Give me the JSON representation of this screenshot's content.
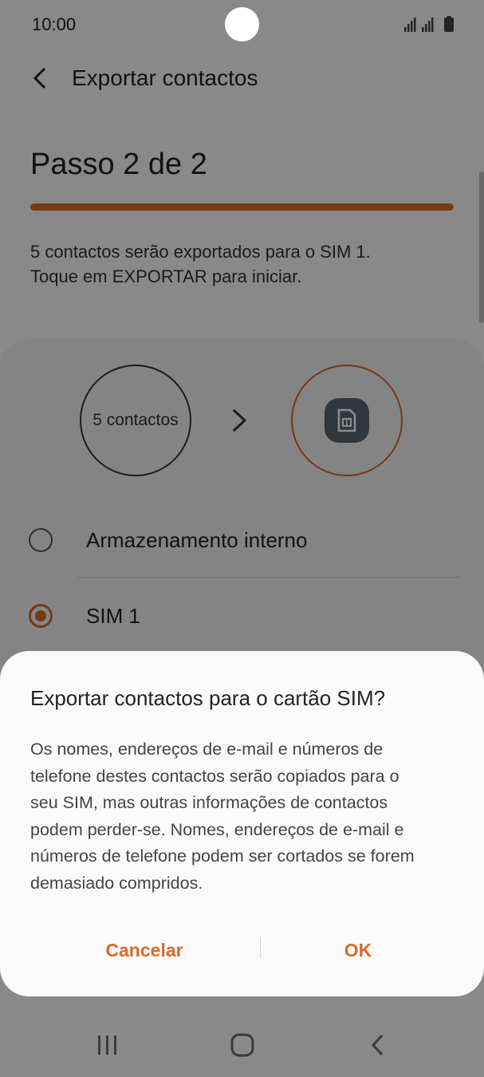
{
  "status_bar": {
    "time": "10:00",
    "signal_icon": "signal-icon",
    "battery_icon": "battery-icon"
  },
  "header": {
    "title": "Exportar contactos",
    "back_icon": "chevron-left-icon"
  },
  "step": {
    "title": "Passo 2 de 2",
    "progress": 1.0
  },
  "description": {
    "line1": "5 contactos serão exportados para o SIM 1.",
    "line2": "Toque em EXPORTAR para iniciar."
  },
  "transfer": {
    "source_label": "5 contactos",
    "arrow_icon": "chevron-right-icon",
    "target_icon": "sim-card-icon"
  },
  "options": [
    {
      "label": "Armazenamento interno",
      "selected": false
    },
    {
      "label": "SIM 1",
      "selected": true
    }
  ],
  "dialog": {
    "title": "Exportar contactos para o cartão SIM?",
    "body_lines": [
      "Os nomes, endereços de e-mail e números de",
      "telefone destes contactos serão copiados para o",
      "seu SIM, mas outras informações de contactos",
      "podem perder-se. Nomes, endereços de e-mail e",
      "números de telefone podem ser cortados se forem",
      "demasiado compridos."
    ],
    "cancel_label": "Cancelar",
    "ok_label": "OK"
  },
  "nav": {
    "recents_icon": "recents-icon",
    "home_icon": "home-icon",
    "back_icon": "back-icon"
  },
  "colors": {
    "accent": "#d96a2a",
    "dim_overlay": "#000000",
    "sim_badge": "#5a6470"
  }
}
